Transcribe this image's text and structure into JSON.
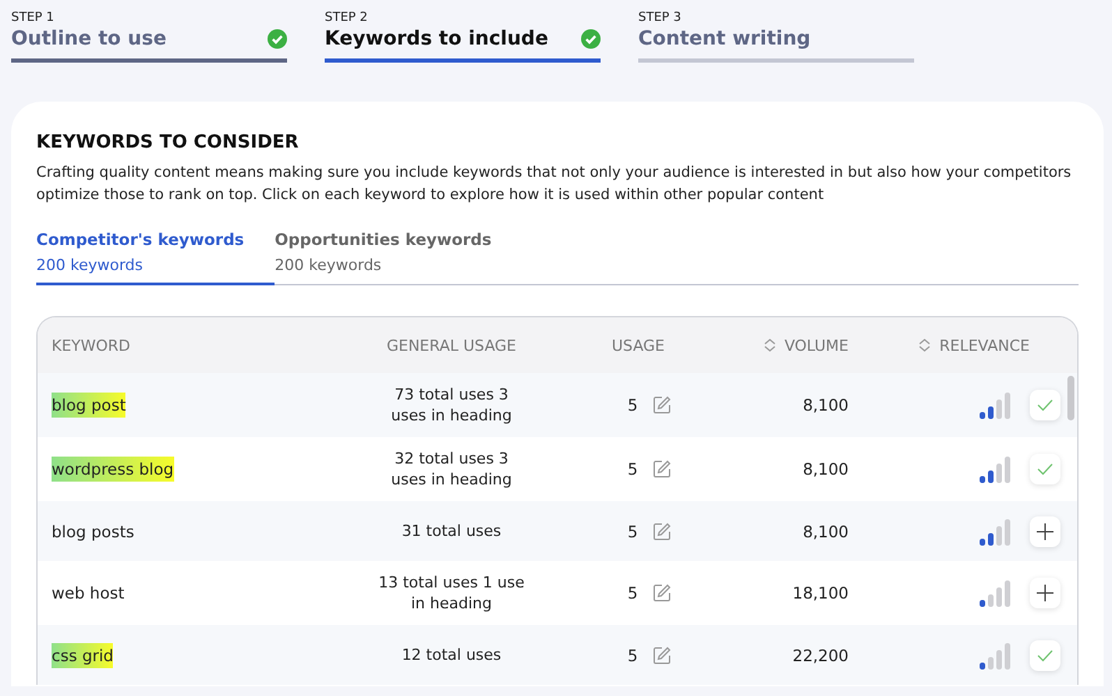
{
  "steps": [
    {
      "label": "STEP 1",
      "title": "Outline to use",
      "completed": true,
      "selected": false
    },
    {
      "label": "STEP 2",
      "title": "Keywords to include",
      "completed": true,
      "selected": true
    },
    {
      "label": "STEP 3",
      "title": "Content writing",
      "completed": false,
      "selected": false
    }
  ],
  "panel": {
    "title": "KEYWORDS TO CONSIDER",
    "description": "Crafting quality content means making sure you include keywords that not only your audience is interested in but also how your competitors optimize those to rank on top. Click on each keyword to explore how it is used within other popular content"
  },
  "tabs": [
    {
      "label": "Competitor's keywords",
      "count": "200 keywords",
      "selected": true
    },
    {
      "label": "Opportunities keywords",
      "count": "200 keywords",
      "selected": false
    }
  ],
  "table": {
    "columns": [
      {
        "label": "KEYWORD",
        "sortable": false
      },
      {
        "label": "GENERAL USAGE",
        "sortable": false
      },
      {
        "label": "USAGE",
        "sortable": false
      },
      {
        "label": "VOLUME",
        "sortable": true
      },
      {
        "label": "RELEVANCE",
        "sortable": true
      }
    ],
    "rows": [
      {
        "keyword": "blog post",
        "highlighted": true,
        "general_usage": "73 total uses 3 uses in heading",
        "usage": "5",
        "volume": "8,100",
        "level": 0.5,
        "added": true
      },
      {
        "keyword": "wordpress blog",
        "highlighted": true,
        "general_usage": "32 total uses 3 uses in heading",
        "usage": "5",
        "volume": "8,100",
        "level": 0.5,
        "added": true
      },
      {
        "keyword": "blog posts",
        "highlighted": false,
        "general_usage": "31 total uses",
        "usage": "5",
        "volume": "8,100",
        "level": 0.5,
        "added": false
      },
      {
        "keyword": "web host",
        "highlighted": false,
        "general_usage": "13 total uses 1 use in heading",
        "usage": "5",
        "volume": "18,100",
        "level": 0.25,
        "added": false
      },
      {
        "keyword": "css grid",
        "highlighted": true,
        "general_usage": "12 total uses",
        "usage": "5",
        "volume": "22,200",
        "level": 0.25,
        "added": true
      }
    ]
  }
}
